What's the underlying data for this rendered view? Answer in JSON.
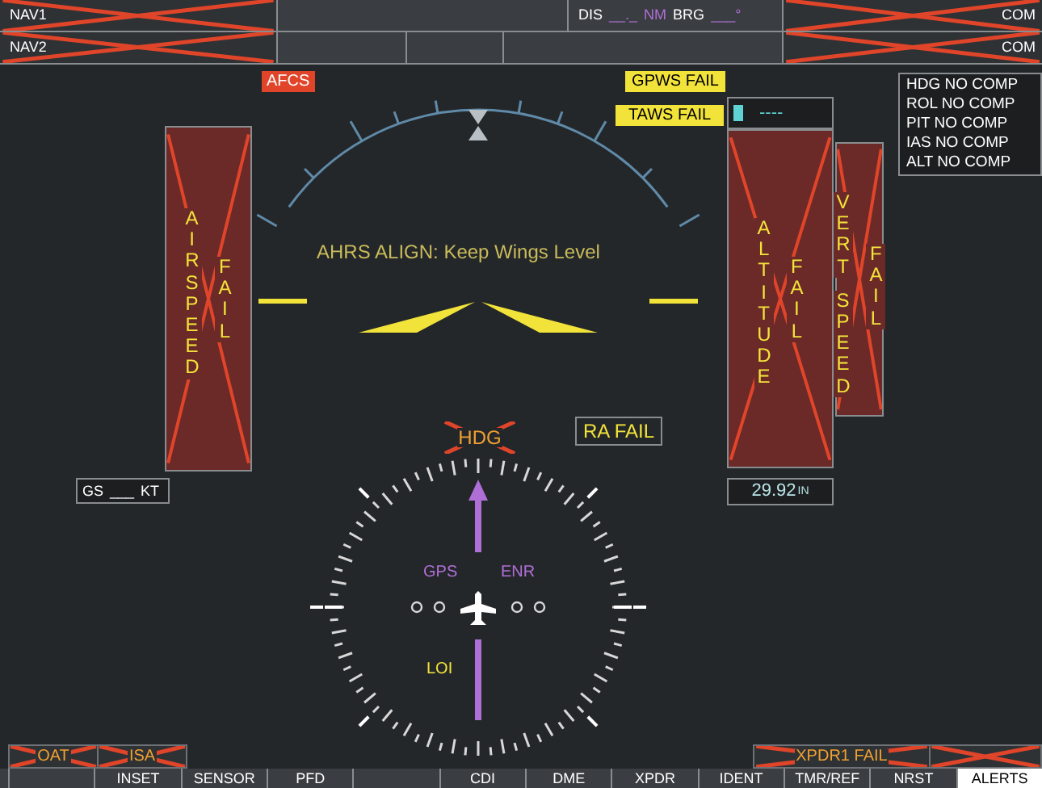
{
  "top_bar": {
    "nav": [
      {
        "label": "NAV1",
        "failed": true
      },
      {
        "label": "NAV2",
        "failed": true
      }
    ],
    "distance_bearing": [
      {
        "kind": "label",
        "text": "DIS"
      },
      {
        "kind": "value",
        "text": "__._"
      },
      {
        "kind": "unit",
        "text": "NM"
      },
      {
        "kind": "label",
        "text": "BRG"
      },
      {
        "kind": "value",
        "text": "___°"
      }
    ],
    "com": [
      {
        "label": "COM",
        "failed": true
      },
      {
        "label": "COM",
        "failed": true
      }
    ]
  },
  "pfd": {
    "afcs_flag": {
      "text": "AFCS",
      "kind": "warning"
    },
    "gpws_flag": {
      "text": "GPWS FAIL",
      "kind": "caution"
    },
    "taws_flag": {
      "text": "TAWS FAIL",
      "kind": "caution"
    },
    "attitude_message": "AHRS ALIGN: Keep Wings Level",
    "airspeed": {
      "failed": true,
      "columns": [
        [
          "AIRSPEED"
        ],
        [
          "FAIL"
        ]
      ]
    },
    "ground_speed": {
      "label": "GS",
      "value": "___",
      "unit": "KT"
    },
    "selected_altitude": "----",
    "altitude": {
      "failed": true,
      "columns": [
        [
          "ALTITUDE"
        ],
        [
          "FAIL"
        ]
      ]
    },
    "vertical_speed": {
      "failed": true,
      "columns": [
        [
          "VERT",
          "SPEED"
        ],
        [
          "FAIL"
        ]
      ]
    },
    "barometer": {
      "value": "29.92",
      "unit": "IN"
    },
    "comparator": [
      "HDG NO COMP",
      "ROL NO COMP",
      "PIT NO COMP",
      "IAS NO COMP",
      "ALT NO COMP"
    ],
    "heading_flag": {
      "text": "HDG",
      "failed": true
    },
    "radar_altimeter": {
      "text": "RA FAIL"
    },
    "hsi": {
      "source": "GPS",
      "mode": "ENR",
      "integrity": "LOI"
    },
    "oat": {
      "text": "OAT",
      "failed": true
    },
    "isa": {
      "text": "ISA",
      "failed": true
    },
    "transponder": {
      "text": "XPDR1 FAIL",
      "failed": true
    },
    "transponder_code": {
      "failed": true
    }
  },
  "softkeys": [
    {
      "selected": false
    },
    {
      "label": "INSET",
      "selected": false
    },
    {
      "label": "SENSOR",
      "selected": false
    },
    {
      "label": "PFD",
      "selected": false
    },
    {
      "selected": false
    },
    {
      "label": "CDI",
      "selected": false
    },
    {
      "label": "DME",
      "selected": false
    },
    {
      "label": "XPDR",
      "selected": false
    },
    {
      "label": "IDENT",
      "selected": false
    },
    {
      "label": "TMR/REF",
      "selected": false
    },
    {
      "label": "NRST",
      "selected": false
    },
    {
      "label": "ALERTS",
      "selected": true
    }
  ]
}
